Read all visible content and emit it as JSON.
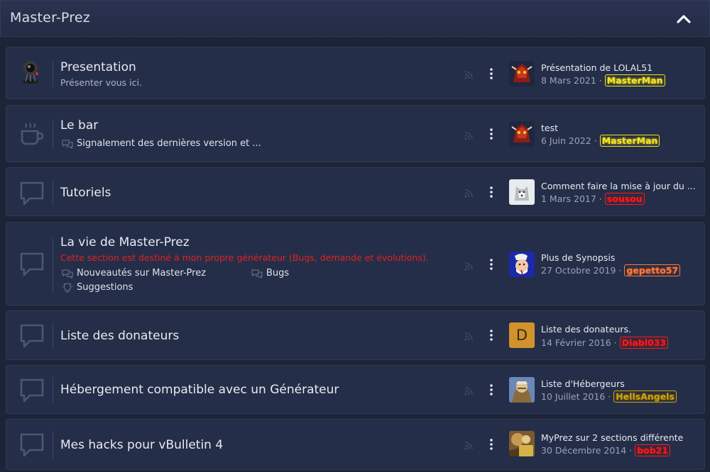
{
  "category": {
    "title": "Master-Prez"
  },
  "forums": [
    {
      "title": "Presentation",
      "description": "Présenter vous ici.",
      "last_post": {
        "title": "Présentation de LOLAL51",
        "date": "8 Mars 2021",
        "user": "MasterMan"
      }
    },
    {
      "title": "Le bar",
      "subforums": [
        "Signalement des dernières version et ..."
      ],
      "last_post": {
        "title": "test",
        "date": "6 Juin 2022",
        "user": "MasterMan"
      }
    },
    {
      "title": "Tutoriels",
      "last_post": {
        "title": "Comment faire la mise à jour du ...",
        "date": "1 Mars 2017",
        "user": "sousou"
      }
    },
    {
      "title": "La vie de Master-Prez",
      "description": "Cette section est destiné à mon propre générateur (Bugs, demande et évolutions).",
      "subforums": [
        "Nouveautés sur Master-Prez",
        "Bugs",
        "Suggestions"
      ],
      "last_post": {
        "title": "Plus de Synopsis",
        "date": "27 Octobre 2019",
        "user": "gepetto57"
      }
    },
    {
      "title": "Liste des donateurs",
      "last_post": {
        "title": "Liste des donateurs.",
        "date": "14 Février 2016",
        "user": "Diabl033",
        "avatar_letter": "D"
      }
    },
    {
      "title": "Hébergement compatible avec un Générateur",
      "last_post": {
        "title": "Liste d'Hébergeurs",
        "date": "10 Juillet 2016",
        "user": "HellsAngels"
      }
    },
    {
      "title": "Mes hacks pour vBulletin 4",
      "last_post": {
        "title": "MyPrez sur 2 sections différente",
        "date": "30 Décembre 2014",
        "user": "bob21"
      }
    }
  ],
  "separator": "·",
  "colors": {
    "background": "#1c2437",
    "row": "#252e48",
    "badge_yellow": "#f6e51a",
    "badge_red": "#ff1a1a",
    "badge_orange": "#ff7a3d",
    "badge_gold": "#d6a400",
    "description_red": "#e0221f"
  }
}
